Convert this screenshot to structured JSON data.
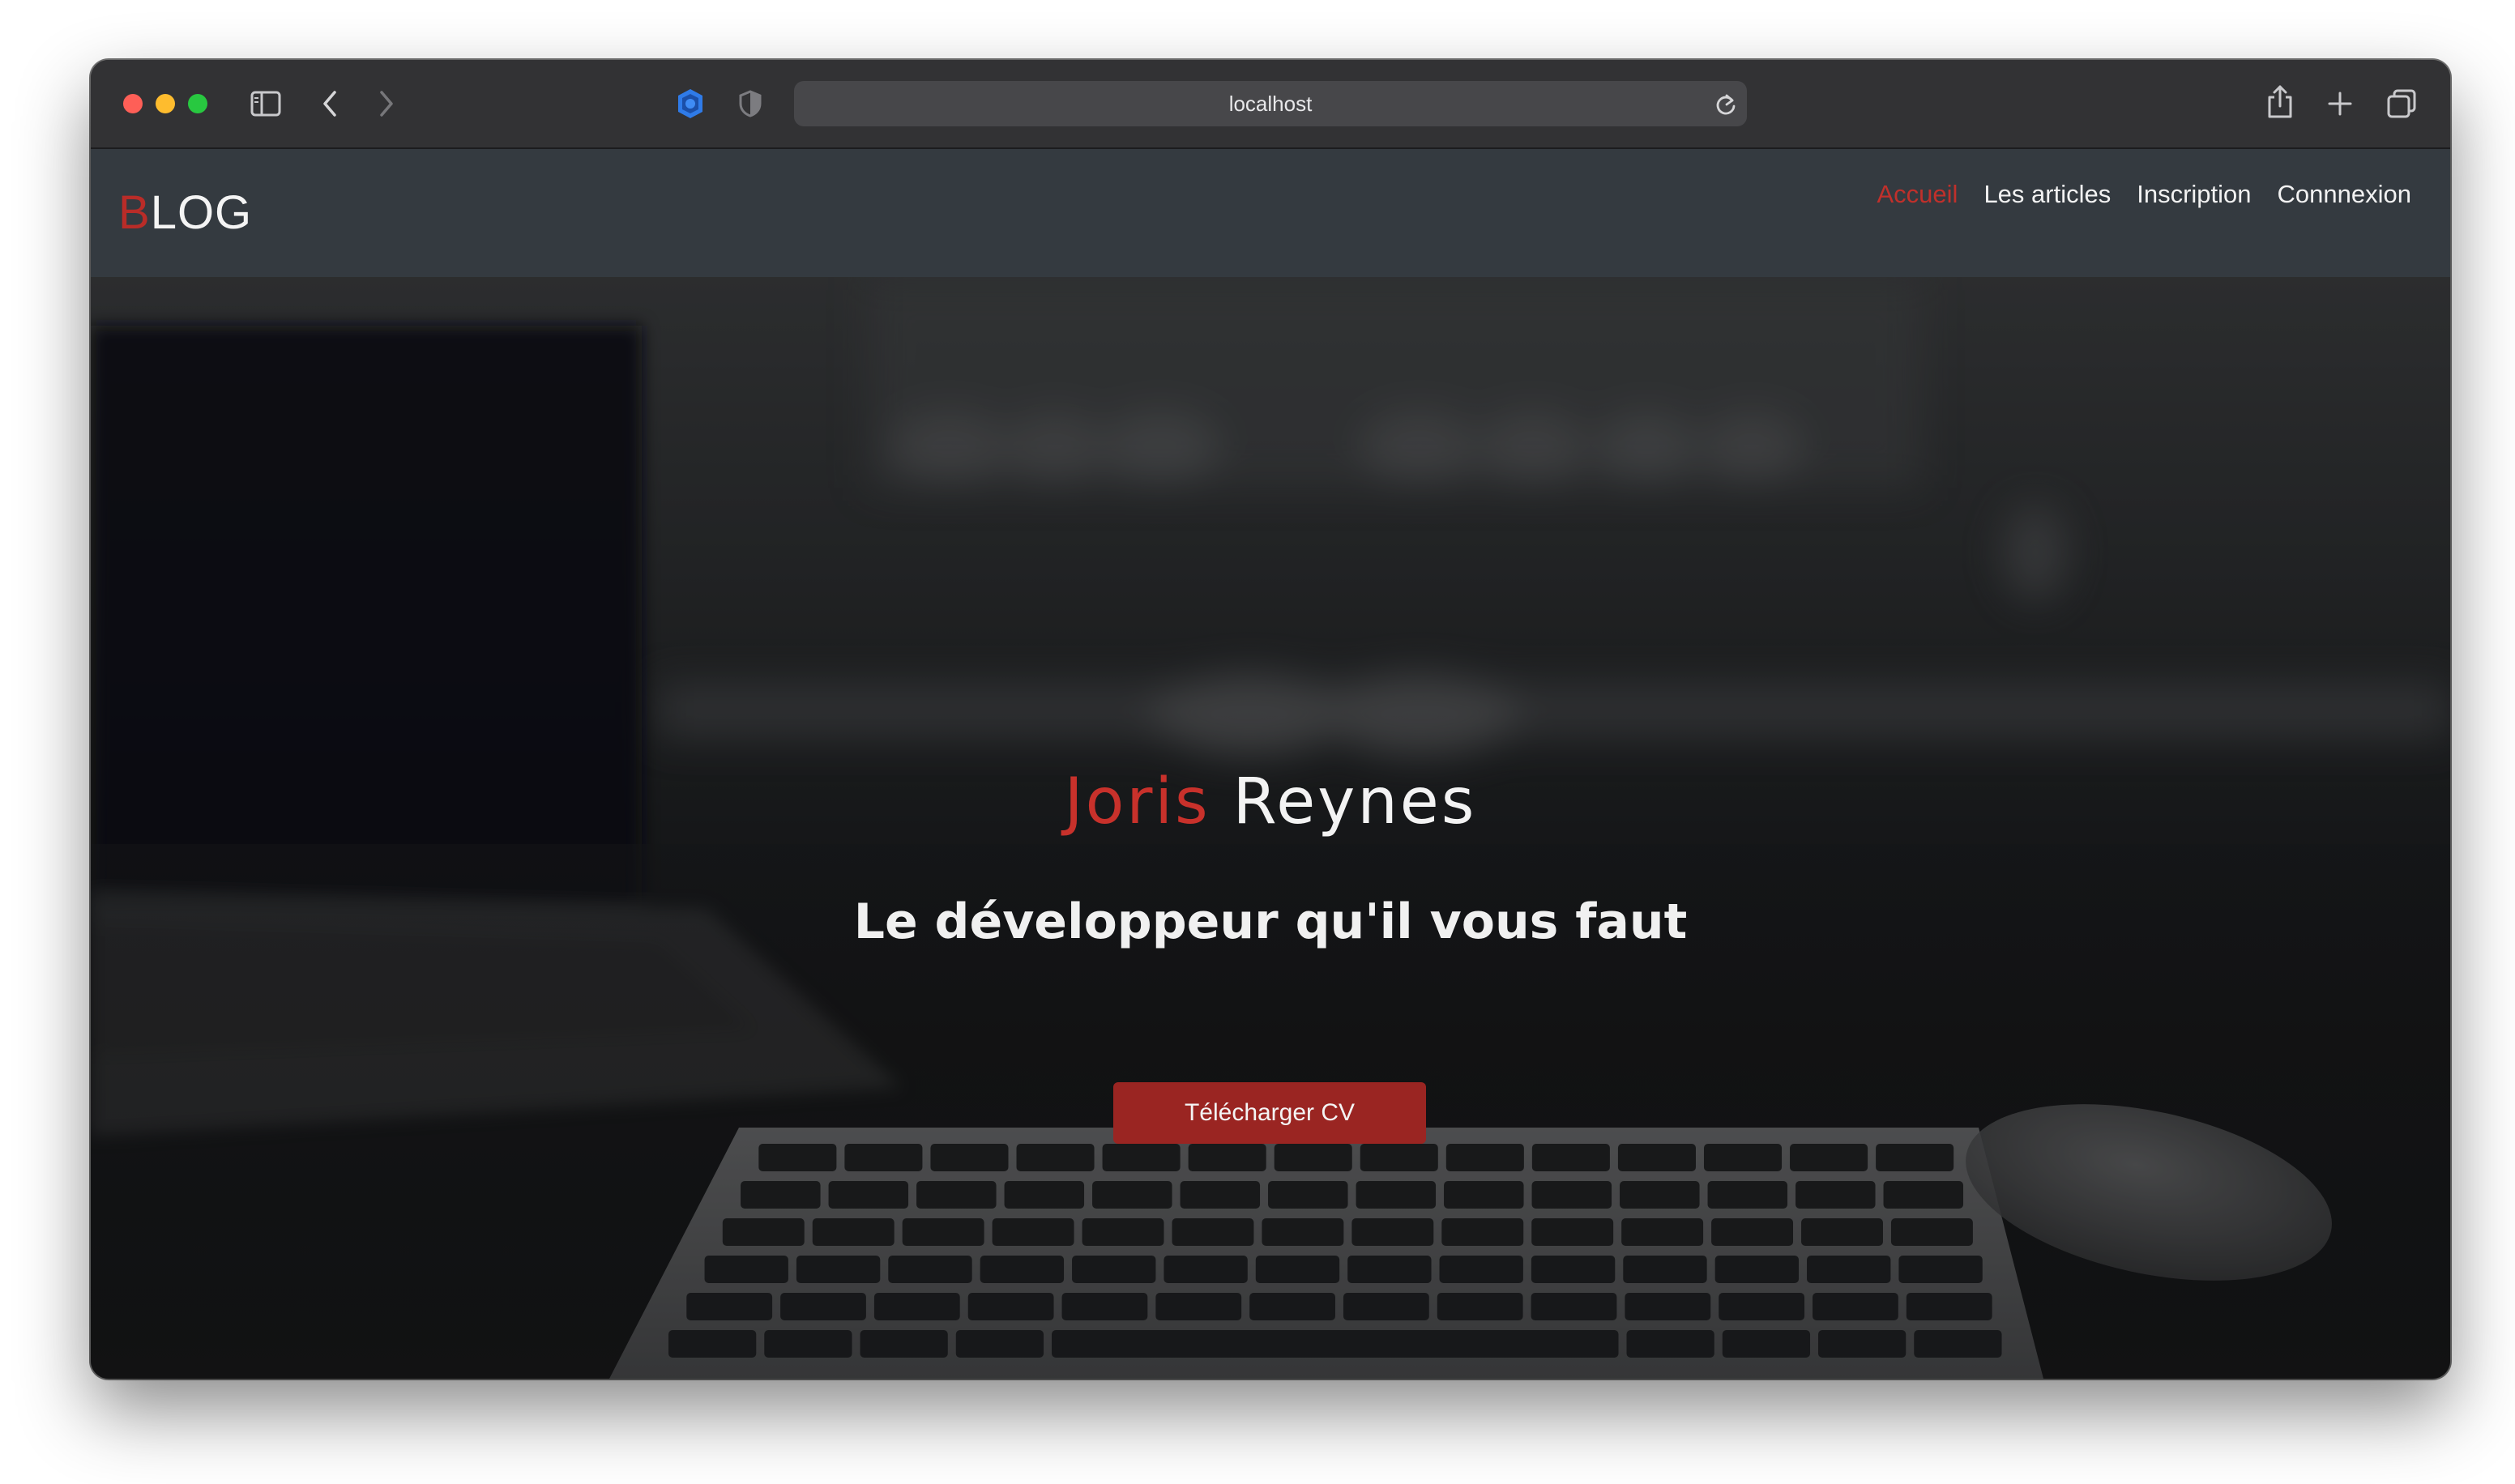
{
  "browser": {
    "address": "localhost",
    "icons": {
      "sidebar": "sidebar-icon",
      "back": "chevron-left-icon",
      "forward": "chevron-right-icon",
      "extension": "extension-icon",
      "privacy": "shield-icon",
      "reload": "reload-icon",
      "share": "share-icon",
      "new_tab": "plus-icon",
      "tabs": "tab-overview-icon"
    }
  },
  "site": {
    "logo_first": "B",
    "logo_rest": "LOG",
    "nav": [
      {
        "label": "Accueil",
        "active": true
      },
      {
        "label": "Les articles",
        "active": false
      },
      {
        "label": "Inscription",
        "active": false
      },
      {
        "label": "Connnexion",
        "active": false
      }
    ]
  },
  "hero": {
    "first_name": "Joris",
    "last_name": "Reynes",
    "subtitle": "Le développeur qu'il vous faut",
    "cta_label": "Télécharger CV"
  },
  "colors": {
    "accent": "#c8312b",
    "header_bg": "#343a40",
    "cta_bg": "#9a2522"
  }
}
